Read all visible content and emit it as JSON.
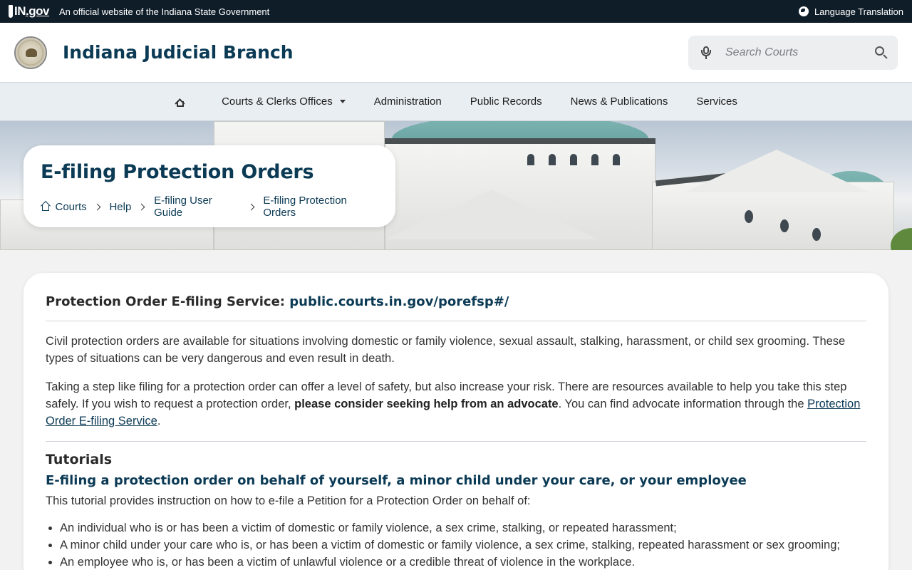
{
  "topbar": {
    "logo_in": "IN",
    "logo_gov": ".gov",
    "official_text": "An official website of the Indiana State Government",
    "language_label": "Language Translation"
  },
  "header": {
    "site_title": "Indiana Judicial Branch",
    "search_placeholder": "Search Courts"
  },
  "nav": {
    "items": [
      {
        "label": "Courts & Clerks Offices",
        "has_dropdown": true
      },
      {
        "label": "Administration"
      },
      {
        "label": "Public Records"
      },
      {
        "label": "News & Publications"
      },
      {
        "label": "Services"
      }
    ]
  },
  "page": {
    "title": "E-filing Protection Orders",
    "breadcrumb": [
      "Courts",
      "Help",
      "E-filing User Guide",
      "E-filing Protection Orders"
    ]
  },
  "content": {
    "service_label": "Protection Order E-filing Service: ",
    "service_url": "public.courts.in.gov/porefsp#/",
    "para1": "Civil protection orders are available for situations involving domestic or family violence, sexual assault, stalking, harassment, or child sex grooming. These types of situations can be very dangerous and even result in death.",
    "para2_a": "Taking a step like filing for a protection order can offer a level of safety, but also increase your risk. There are resources available to help you take this step safely. If you wish to request a protection order, ",
    "para2_bold": "please consider seeking help from an advocate",
    "para2_b": ". You can find advocate information through the ",
    "para2_link": "Protection Order E-filing Service",
    "para2_c": ".",
    "tutorials_heading": "Tutorials",
    "tutorial_title": "E-filing a protection order on behalf of yourself, a minor child under your care, or your employee",
    "tutorial_intro": "This tutorial provides instruction on how to e-file a Petition for a Protection Order on behalf of:",
    "tutorial_items": [
      "An individual who is or has been a victim of domestic or family violence, a sex crime, stalking, or repeated harassment;",
      "A minor child under your care who is, or has been a victim of domestic or family violence, a sex crime, stalking, repeated harassment or sex grooming;",
      "An employee who is, or has been a victim of unlawful violence or a credible threat of violence in the workplace."
    ]
  },
  "colors": {
    "topbar_bg": "#0f1d29",
    "brand_navy": "#0b3a55",
    "nav_bg": "#e9eef2"
  }
}
